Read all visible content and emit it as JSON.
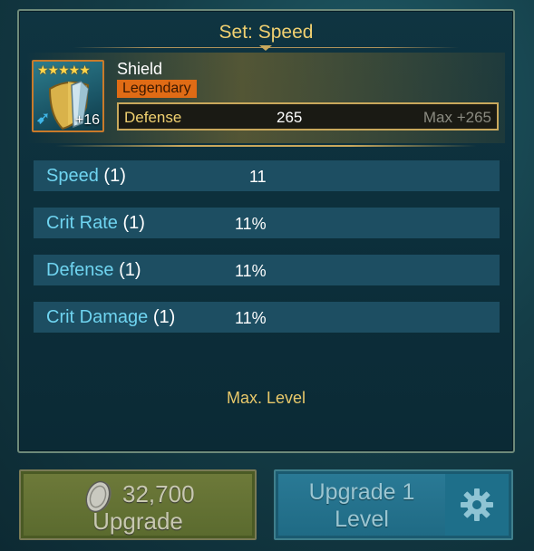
{
  "set_title": "Set: Speed",
  "item": {
    "name": "Shield",
    "rarity": "Legendary",
    "stars": "★★★★★",
    "level": "+16",
    "primary_stat": {
      "label": "Defense",
      "value": "265",
      "max": "Max +265"
    }
  },
  "substats": [
    {
      "name": "Speed",
      "count": "(1)",
      "value": "11"
    },
    {
      "name": "Crit Rate",
      "count": "(1)",
      "value": "11%"
    },
    {
      "name": "Defense",
      "count": "(1)",
      "value": "11%"
    },
    {
      "name": "Crit Damage",
      "count": "(1)",
      "value": "11%"
    }
  ],
  "status": "Max. Level",
  "buttons": {
    "upgrade": {
      "cost": "32,700",
      "label": "Upgrade"
    },
    "upgrade_one": {
      "label_line1": "Upgrade 1",
      "label_line2": "Level"
    }
  },
  "colors": {
    "accent_gold": "#f0d070",
    "rarity_orange": "#e06b15",
    "substat_name": "#6fd4f0",
    "substat_row": "#1d4e62"
  },
  "icons": {
    "set": "speed-set-icon",
    "coin": "silver-coin-icon",
    "settings": "gear-icon"
  }
}
